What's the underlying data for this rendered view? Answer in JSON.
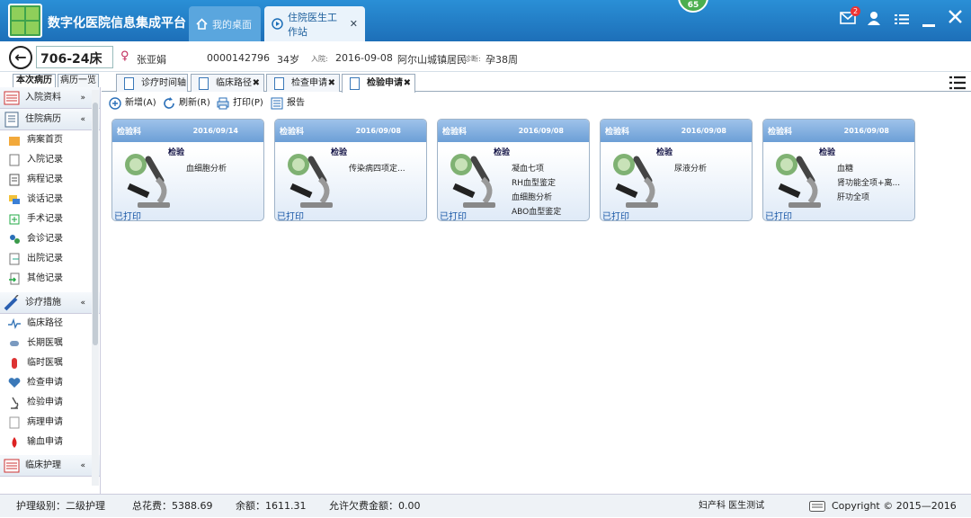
{
  "app": {
    "title": "数字化医院信息集成平台"
  },
  "top_tabs": [
    {
      "label": "我的桌面"
    },
    {
      "label": "住院医生工作站",
      "close": "✕"
    }
  ],
  "top_badge": "65",
  "mail_count": "2",
  "patient": {
    "bed": "706-24床",
    "name": "张亚娟",
    "id": "0000142796",
    "age": "34岁",
    "admit_label": "入院:",
    "admit_date": "2016-09-08",
    "area": "阿尔山城镇居民",
    "diag_label": "诊断:",
    "diagnosis": "孕38周"
  },
  "side_tabs": [
    "本次病历",
    "病历一览"
  ],
  "sidebar": {
    "g1": {
      "label": "入院资料",
      "chev": "»"
    },
    "g2": {
      "label": "住院病历",
      "chev": "«"
    },
    "records": [
      "病案首页",
      "入院记录",
      "病程记录",
      "谈话记录",
      "手术记录",
      "会诊记录",
      "出院记录",
      "其他记录"
    ],
    "g3": {
      "label": "诊疗措施",
      "chev": "«"
    },
    "measures": [
      "临床路径",
      "长期医嘱",
      "临时医嘱",
      "检查申请",
      "检验申请",
      "病理申请",
      "输血申请"
    ],
    "g4": {
      "label": "临床护理",
      "chev": "«"
    }
  },
  "content_tabs": [
    {
      "label": "诊疗时间轴"
    },
    {
      "label": "临床路径"
    },
    {
      "label": "检查申请"
    },
    {
      "label": "检验申请"
    }
  ],
  "toolbar": {
    "add": "新增(A)",
    "refresh": "刷新(R)",
    "print": "打印(P)",
    "report": "报告"
  },
  "cards": [
    {
      "dept": "检验科",
      "date": "2016/09/14",
      "type": "检验",
      "items": [
        "血细胞分析"
      ],
      "status": "已打印"
    },
    {
      "dept": "检验科",
      "date": "2016/09/08",
      "type": "检验",
      "items": [
        "传染病四项定..."
      ],
      "status": "已打印"
    },
    {
      "dept": "检验科",
      "date": "2016/09/08",
      "type": "检验",
      "items": [
        "凝血七项",
        "RH血型鉴定",
        "血细胞分析",
        "ABO血型鉴定"
      ],
      "status": "已打印"
    },
    {
      "dept": "检验科",
      "date": "2016/09/08",
      "type": "检验",
      "items": [
        "尿液分析"
      ],
      "status": "已打印"
    },
    {
      "dept": "检验科",
      "date": "2016/09/08",
      "type": "检验",
      "items": [
        "血糖",
        "肾功能全项+离...",
        "肝功全项"
      ],
      "status": "已打印"
    }
  ],
  "footer": {
    "nurse": "护理级别：二级护理",
    "total": "总花费：5388.69",
    "balance": "余额：1611.31",
    "arrears": "允许欠费金额：0.00",
    "dept_user": "妇产科 医生测试",
    "copyright": "Copyright © 2015—2016"
  }
}
